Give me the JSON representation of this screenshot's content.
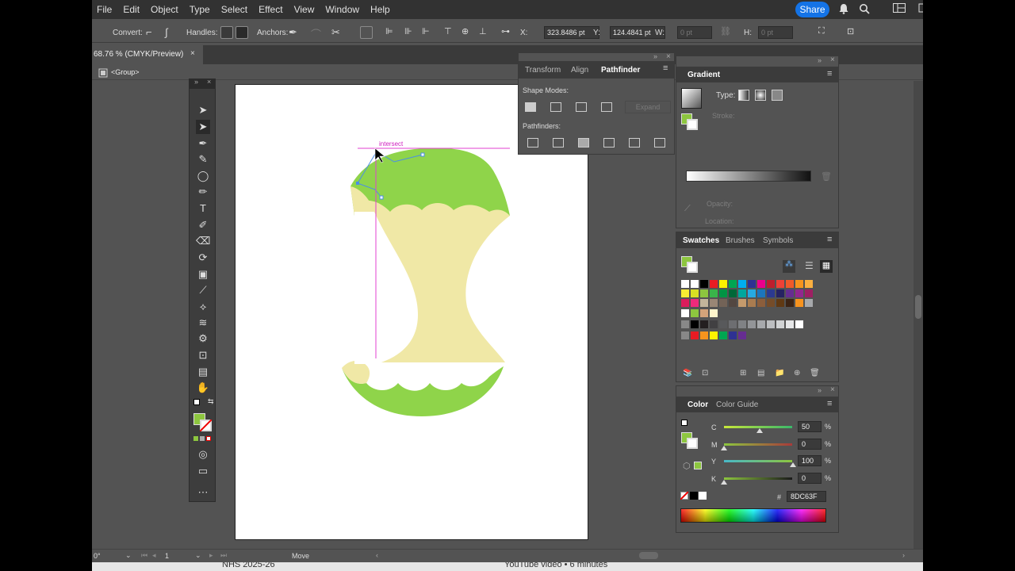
{
  "menu": [
    "File",
    "Edit",
    "Object",
    "Type",
    "Select",
    "Effect",
    "View",
    "Window",
    "Help"
  ],
  "share_label": "Share",
  "control": {
    "convert_label": "Convert:",
    "handles_label": "Handles:",
    "anchors_label": "Anchors:",
    "x_label": "X:",
    "x_value": "323.8486 pt",
    "y_label": "Y:",
    "y_value": "124.4841 pt",
    "w_label": "W:",
    "w_value": "0 pt",
    "h_label": "H:",
    "h_value": "0 pt"
  },
  "doc_tab": "68.76 % (CMYK/Preview)",
  "doc_close": "×",
  "breadcrumb": "<Group>",
  "smart_guide": "intersect",
  "pathfinder": {
    "tabs": [
      "Transform",
      "Align",
      "Pathfinder"
    ],
    "shape_modes": "Shape Modes:",
    "expand": "Expand",
    "pathfinders": "Pathfinders:"
  },
  "gradient": {
    "title": "Gradient",
    "type": "Type:",
    "stroke": "Stroke:",
    "opacity": "Opacity:",
    "location": "Location:"
  },
  "swatches": {
    "tabs": [
      "Swatches",
      "Brushes",
      "Symbols"
    ],
    "rows": [
      [
        "#ffffff",
        "#ffffff",
        "#000000",
        "#e81b23",
        "#fff200",
        "#00a651",
        "#00aeef",
        "#2e3192",
        "#ec008c",
        "#be1e2d",
        "#ef4136",
        "#f15a29",
        "#f7941d",
        "#fbb040"
      ],
      [
        "#f9ed32",
        "#d7df23",
        "#8dc63f",
        "#39b54a",
        "#009444",
        "#006838",
        "#00a79d",
        "#27aae1",
        "#1c75bc",
        "#2b3990",
        "#262262",
        "#662d91",
        "#92278f",
        "#9e1f63"
      ],
      [
        "#da1c5c",
        "#ee2a7b",
        "#c2b59b",
        "#998675",
        "#736357",
        "#534741",
        "#c49a6c",
        "#a97c50",
        "#8b5e3c",
        "#754c29",
        "#603913",
        "#3c2415",
        "#f7931e",
        "#a7a9ac"
      ],
      [
        "#ffffff",
        "#8dc63f",
        "#d4a37a",
        "#fff5cc"
      ],
      [
        "#000000",
        "#231f20",
        "#414042",
        "#58595b",
        "#6d6e71",
        "#808285",
        "#939598",
        "#a7a9ac",
        "#bcbec0",
        "#d1d3d4",
        "#e6e7e8",
        "#ffffff"
      ],
      [
        "#e81b23",
        "#f7941d",
        "#fff200",
        "#00a651",
        "#2e3192",
        "#662d91"
      ]
    ]
  },
  "color": {
    "tabs": [
      "Color",
      "Color Guide"
    ],
    "c_label": "C",
    "c_value": "50",
    "m_label": "M",
    "m_value": "0",
    "y_label": "Y",
    "y_value": "100",
    "k_label": "K",
    "k_value": "0",
    "pct": "%",
    "hex_label": "#",
    "hex": "8DC63F",
    "fill": "#8dc63f"
  },
  "status": {
    "zoom": "0°",
    "page": "1",
    "tool": "Move"
  },
  "bottom_strip": [
    "NHS 2025-26",
    "YouTube video • 6 minutes"
  ],
  "icons": [
    "selection-tool",
    "direct-selection-tool",
    "pen-tool",
    "curvature-tool",
    "ellipse-tool",
    "paintbrush-tool",
    "type-tool",
    "shaper-tool",
    "eraser-tool",
    "lasso-tool",
    "gradient-tool",
    "eyedropper-tool",
    "blend-tool",
    "width-tool",
    "puppet-warp-tool",
    "artboard-tool",
    "graph-tool",
    "hand-tool"
  ]
}
